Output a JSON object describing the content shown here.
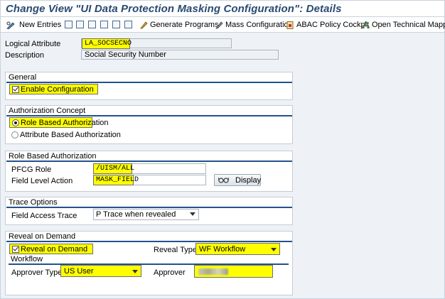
{
  "title": "Change View \"UI Data Protection Masking Configuration\": Details",
  "toolbar": {
    "new_entries": "New Entries",
    "generate_programs": "Generate Programs",
    "mass_configuration": "Mass Configuration",
    "abac_policy_cockpit": "ABAC Policy Cockpit",
    "open_technical_mapping": "Open Technical Mapping"
  },
  "header": {
    "logical_attribute_label": "Logical Attribute",
    "logical_attribute_value": "LA_SOCSECNO",
    "description_label": "Description",
    "description_value": "Social Security Number"
  },
  "general": {
    "title": "General",
    "enable_configuration_label": "Enable Configuration",
    "enable_configuration_checked": true
  },
  "authorization_concept": {
    "title": "Authorization Concept",
    "role_based_label": "Role Based Authorization",
    "attribute_based_label": "Attribute Based Authorization",
    "selected": "role_based"
  },
  "role_based_authorization": {
    "title": "Role Based Authorization",
    "pfcg_role_label": "PFCG Role",
    "pfcg_role_value": "/UISM/ALL",
    "field_level_action_label": "Field Level Action",
    "field_level_action_value": "MASK_FIELD",
    "display_button_label": "Display"
  },
  "trace_options": {
    "title": "Trace Options",
    "field_access_trace_label": "Field Access Trace",
    "field_access_trace_value": "P Trace when revealed"
  },
  "reveal_on_demand": {
    "title": "Reveal on Demand",
    "reveal_on_demand_label": "Reveal on Demand",
    "reveal_on_demand_checked": true,
    "reveal_type_label": "Reveal Type",
    "reveal_type_value": "WF Workflow",
    "workflow": {
      "title": "Workflow",
      "approver_type_label": "Approver Type",
      "approver_type_value": "US User",
      "approver_label": "Approver"
    }
  },
  "colors": {
    "highlight": "#ffff00",
    "group_line": "#23518e",
    "title_text": "#2a4a72"
  }
}
